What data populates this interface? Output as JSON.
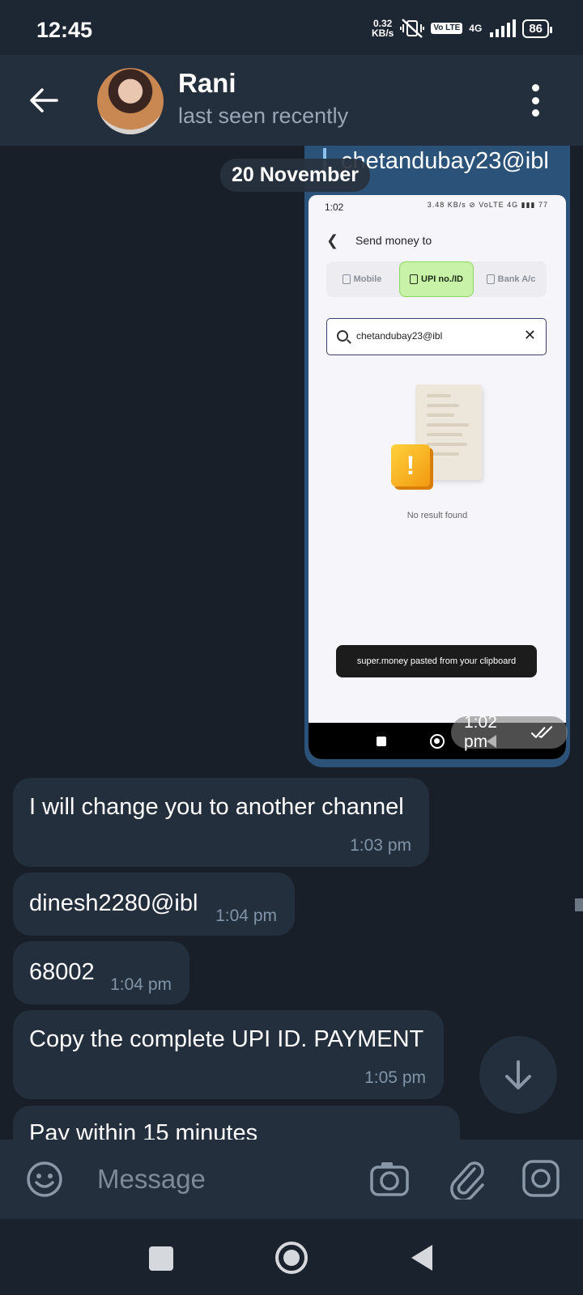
{
  "status_bar": {
    "time": "12:45",
    "net_speed": "0.32",
    "net_unit": "KB/s",
    "volte": "Vo LTE",
    "network": "4G",
    "battery": "86"
  },
  "header": {
    "name": "Rani",
    "status": "last seen recently"
  },
  "chat": {
    "date": "20 November",
    "media_message": {
      "reply_text": "chetandubay23@ibl",
      "time": "1:02 pm",
      "screenshot": {
        "time": "1:02",
        "icons": "3.48 KB/s ⊘ VoLTE 4G ▮▮▮ 77",
        "title": "Send money to",
        "tabs": [
          "Mobile",
          "UPI no./ID",
          "Bank A/c"
        ],
        "search_value": "chetandubay23@ibl",
        "empty_text": "No result found",
        "toast": "super.money pasted from your clipboard"
      }
    },
    "messages": [
      {
        "text": "I will change you to another channel",
        "time": "1:03 pm"
      },
      {
        "text": "dinesh2280@ibl",
        "time": "1:04 pm"
      },
      {
        "text": "68002",
        "time": "1:04 pm"
      },
      {
        "text": "Copy the complete UPI ID.  PAYMENT",
        "time": "1:05 pm"
      },
      {
        "text": "Pay within 15 minutes",
        "time": ""
      }
    ]
  },
  "composer": {
    "placeholder": "Message"
  },
  "colors": {
    "background": "#181f29",
    "header": "#242f3d",
    "bubble_in": "#242f3d",
    "bubble_out": "#2b5278",
    "accent_green": "#c8f2a8"
  }
}
